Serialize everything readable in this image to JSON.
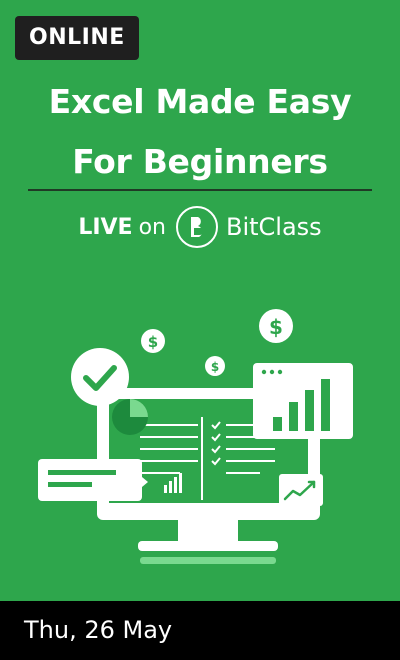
{
  "badge": "ONLINE",
  "title": {
    "line1": "Excel Made Easy",
    "line2": "For Beginners"
  },
  "live": {
    "live_text": "LIVE",
    "on_text": "on",
    "brand": "BitClass"
  },
  "illustration": {
    "icons": [
      "dollar-coin-icon",
      "checkmark-circle-icon",
      "pie-chart-icon",
      "bar-chart-icon",
      "trend-line-icon",
      "monitor-icon"
    ]
  },
  "footer": {
    "date": "Thu, 26 May"
  },
  "colors": {
    "background": "#2ea64c",
    "dark": "#1f1f1f",
    "accent_light": "#7ad98f"
  }
}
